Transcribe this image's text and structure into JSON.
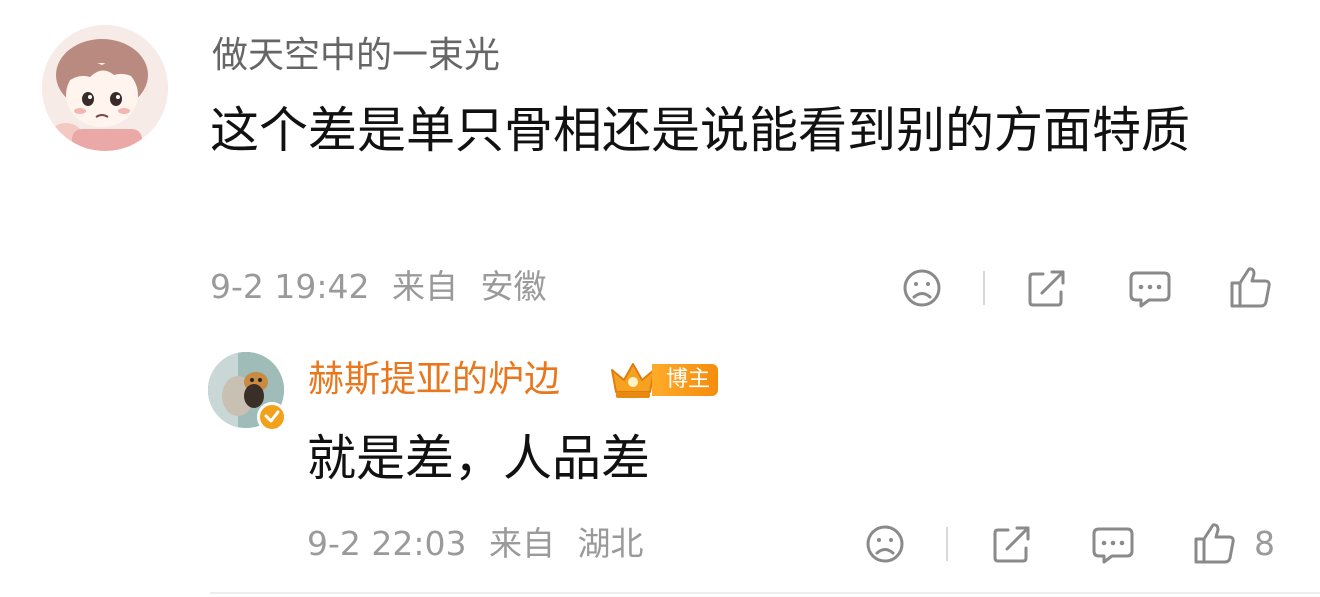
{
  "comments": [
    {
      "username": "做天空中的一束光",
      "text": "这个差是单只骨相还是说能看到别的方面特质",
      "date": "9-2 19:42",
      "source_prefix": "来自",
      "location": "安徽",
      "like_count": ""
    },
    {
      "username": "赫斯提亚的炉边",
      "badge": "博主",
      "text": "就是差，人品差",
      "date": "9-2 22:03",
      "source_prefix": "来自",
      "location": "湖北",
      "like_count": "8"
    }
  ],
  "icons": {
    "dislike": "sad-face-icon",
    "share": "share-icon",
    "comment": "comment-bubble-icon",
    "like": "thumbs-up-icon"
  },
  "colors": {
    "author_name": "#e8771e",
    "badge": "#f7961a",
    "meta": "#9a9a9a",
    "username": "#666666"
  }
}
